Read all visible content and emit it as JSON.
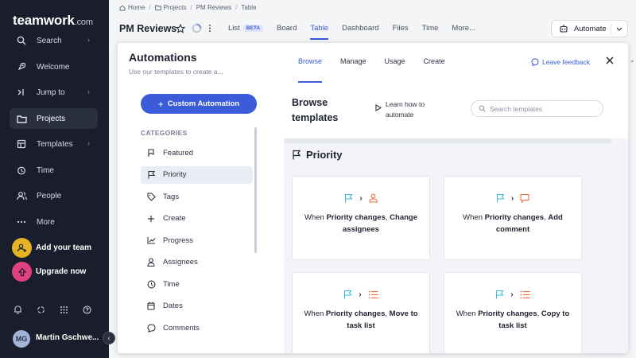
{
  "sidebar": {
    "logo": "teamwork",
    "logo_domain": ".com",
    "items": [
      {
        "label": "Search",
        "icon": "search-icon",
        "has_chevron": true
      },
      {
        "label": "Welcome",
        "icon": "rocket-icon",
        "has_chevron": false
      },
      {
        "label": "Jump to",
        "icon": "jump-to-icon",
        "has_chevron": true
      },
      {
        "label": "Projects",
        "icon": "folder-icon",
        "has_chevron": false,
        "active": true
      },
      {
        "label": "Templates",
        "icon": "templates-icon",
        "has_chevron": true
      },
      {
        "label": "Time",
        "icon": "clock-icon",
        "has_chevron": false
      },
      {
        "label": "People",
        "icon": "people-icon",
        "has_chevron": false
      },
      {
        "label": "More",
        "icon": "more-dots-icon",
        "has_chevron": false
      }
    ],
    "add_team": "Add your team",
    "upgrade": "Upgrade now",
    "user_initials": "MG",
    "user_name": "Martin Gschwe..."
  },
  "breadcrumb": [
    "Home",
    "Projects",
    "PM Reviews",
    "Table"
  ],
  "page": {
    "title": "PM Reviews",
    "tabs": [
      {
        "label": "List",
        "badge": "BETA"
      },
      {
        "label": "Board"
      },
      {
        "label": "Table",
        "active": true
      },
      {
        "label": "Dashboard"
      },
      {
        "label": "Files"
      },
      {
        "label": "Time"
      },
      {
        "label": "More..."
      }
    ],
    "automate_label": "Automate"
  },
  "modal": {
    "title": "Automations",
    "subtitle": "Use our templates to create a...",
    "tabs": [
      "Browse",
      "Manage",
      "Usage",
      "Create"
    ],
    "active_tab": "Browse",
    "feedback": "Leave feedback",
    "custom_button": "Custom Automation",
    "categories_heading": "CATEGORIES",
    "categories": [
      {
        "label": "Featured",
        "icon": "flag-outline-icon"
      },
      {
        "label": "Priority",
        "icon": "flag-icon",
        "active": true
      },
      {
        "label": "Tags",
        "icon": "tag-icon"
      },
      {
        "label": "Create",
        "icon": "plus-icon"
      },
      {
        "label": "Progress",
        "icon": "chart-line-icon"
      },
      {
        "label": "Assignees",
        "icon": "person-icon"
      },
      {
        "label": "Time",
        "icon": "clock-icon"
      },
      {
        "label": "Dates",
        "icon": "calendar-icon"
      },
      {
        "label": "Comments",
        "icon": "comment-icon"
      }
    ],
    "browse_title_line1": "Browse",
    "browse_title_line2": "templates",
    "learn_line1": "Learn how to",
    "learn_line2": "automate",
    "search_placeholder": "Search templates",
    "section_title": "Priority",
    "cards": [
      {
        "prefix": "When ",
        "bold1": "Priority changes",
        "mid": ", ",
        "bold2": "Change assignees",
        "action_icon": "person-icon"
      },
      {
        "prefix": "When ",
        "bold1": "Priority changes",
        "mid": ", ",
        "bold2": "Add comment",
        "action_icon": "comment-icon"
      },
      {
        "prefix": "When ",
        "bold1": "Priority changes",
        "mid": ", ",
        "bold2": "Move to task list",
        "action_icon": "list-icon"
      },
      {
        "prefix": "When ",
        "bold1": "Priority changes",
        "mid": ", ",
        "bold2": "Copy to task list",
        "action_icon": "list-icon"
      }
    ]
  },
  "colors": {
    "accent": "#3b5bdb",
    "sidebar_bg": "#1a1e2c",
    "trigger_icon": "#3db8e0",
    "action_icon": "#f26a3d",
    "add_team_badge": "#e6b325",
    "upgrade_badge": "#e0417f"
  }
}
